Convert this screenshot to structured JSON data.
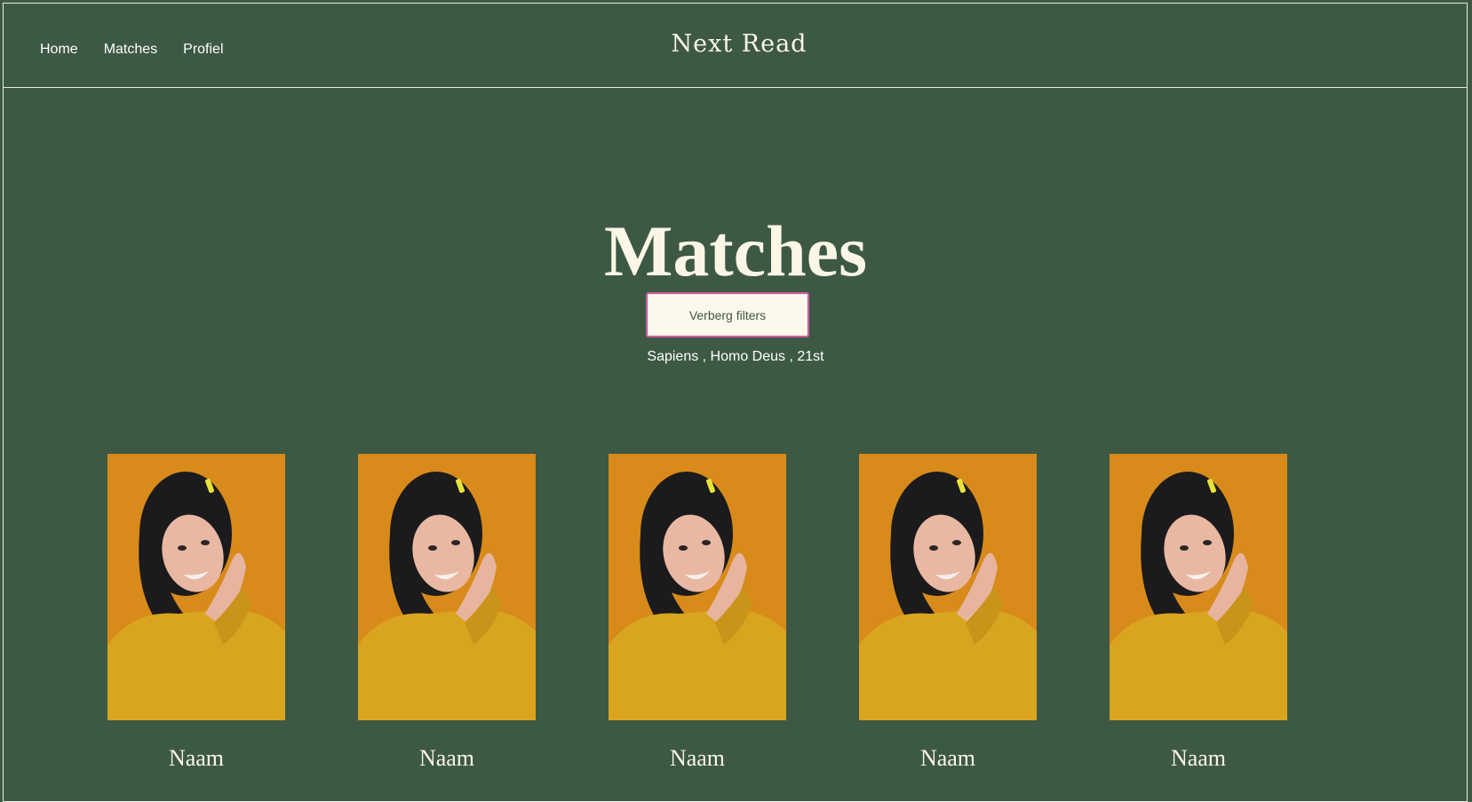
{
  "nav": {
    "items": [
      "Home",
      "Matches",
      "Profiel"
    ]
  },
  "brand": "Next Read",
  "page": {
    "title": "Matches"
  },
  "filters": {
    "toggle_label": "Verberg filters",
    "summary": "Sapiens , Homo Deus , 21st"
  },
  "matches": [
    {
      "name": "Naam"
    },
    {
      "name": "Naam"
    },
    {
      "name": "Naam"
    },
    {
      "name": "Naam"
    },
    {
      "name": "Naam"
    }
  ],
  "colors": {
    "background": "#3d5944",
    "text": "#fbf6e6",
    "button_bg": "#fcf8ec",
    "button_border": "#cd5c9b",
    "photo_bg": "#d88a1a",
    "sweater": "#d9a51f"
  }
}
